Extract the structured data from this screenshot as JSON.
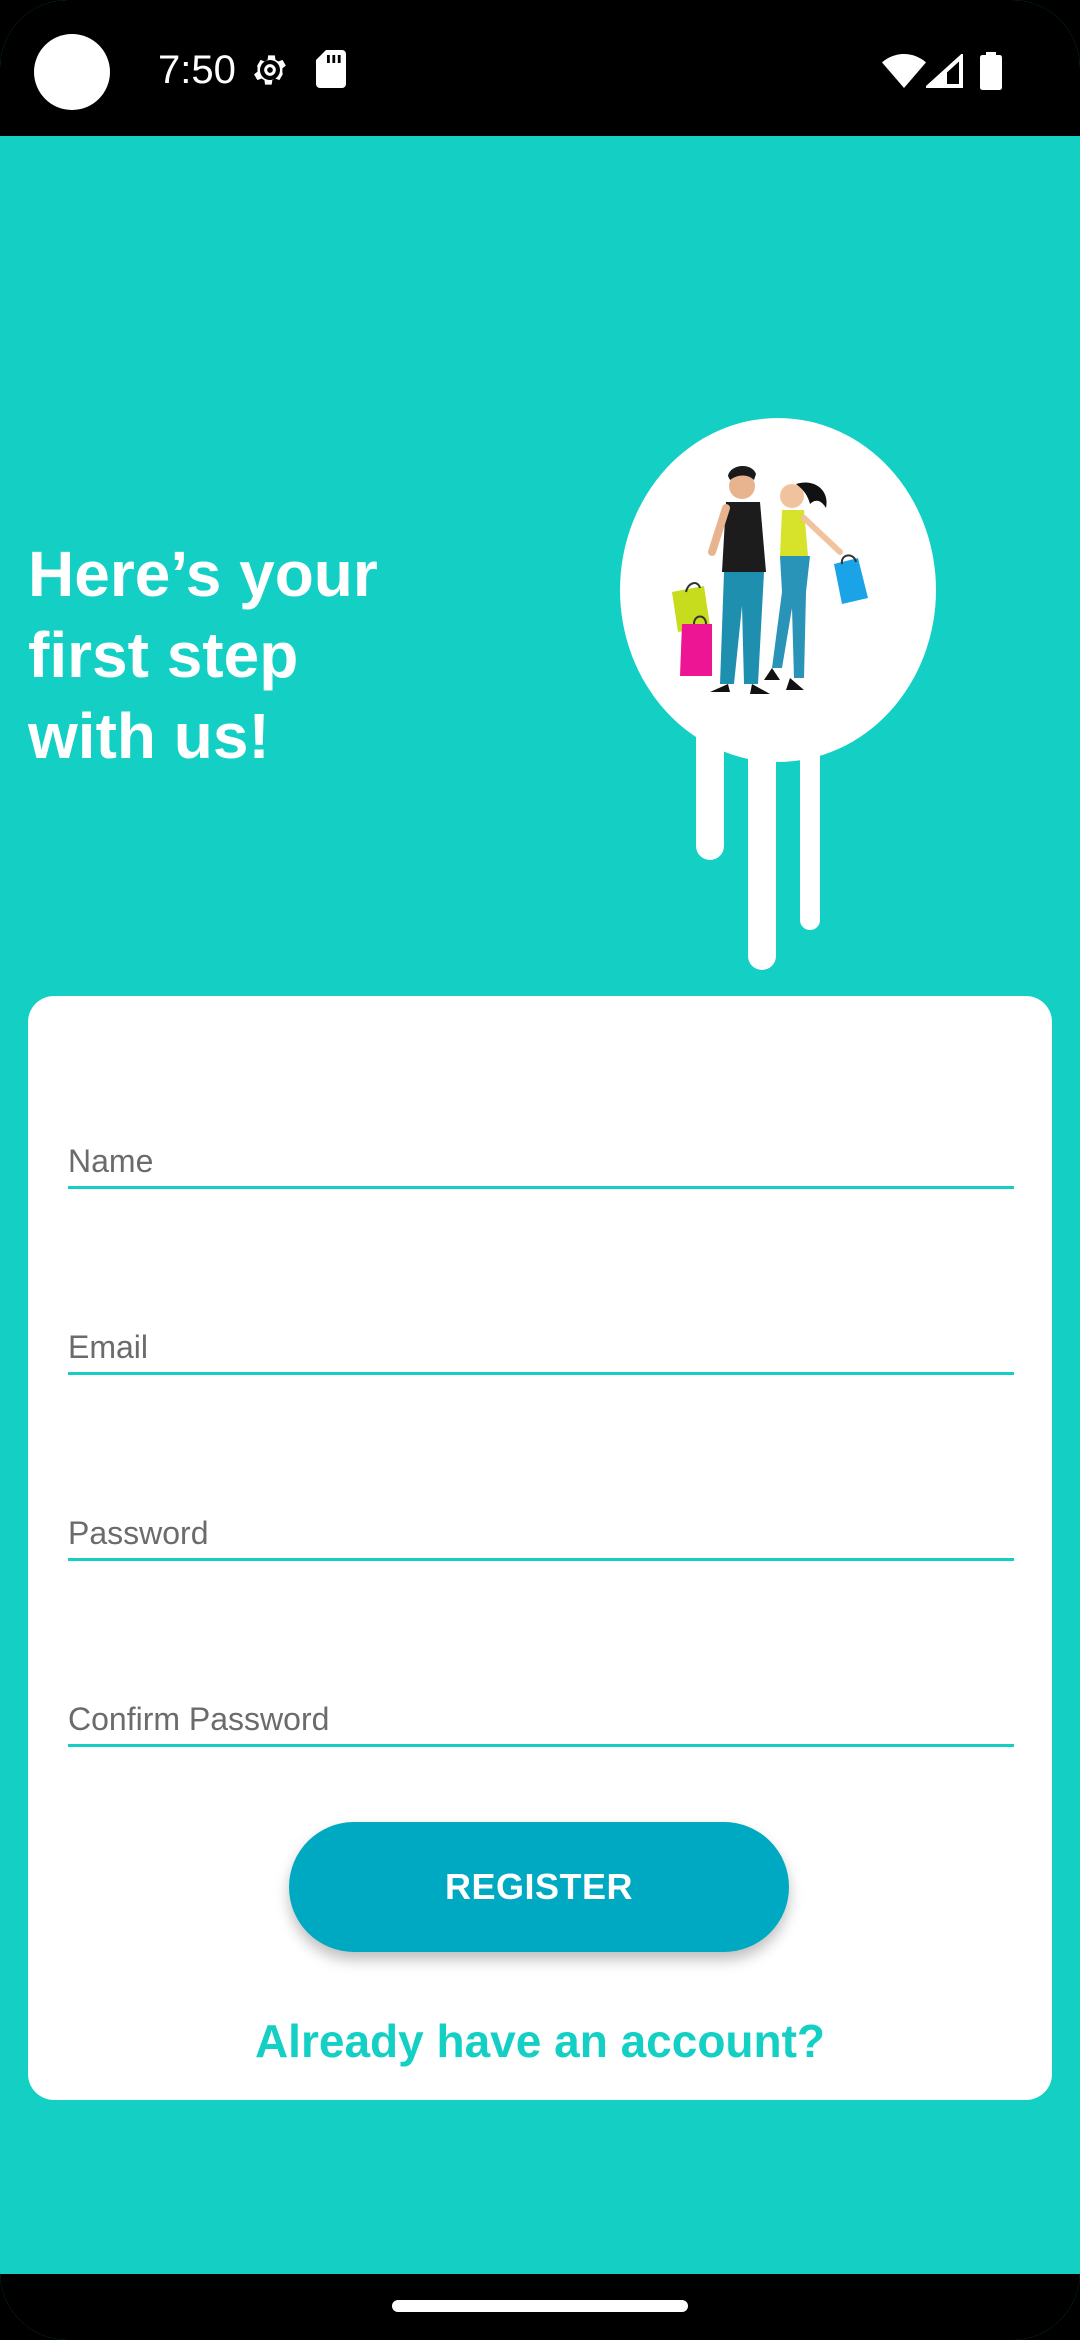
{
  "status_bar": {
    "time": "7:50",
    "icons": [
      "camera-cutout",
      "gear-icon",
      "sd-card-icon",
      "wifi-icon",
      "signal-icon",
      "battery-icon"
    ]
  },
  "header": {
    "headline": "Here’s your first step with us!"
  },
  "illustration": {
    "icon": "shopping-couple-illustration"
  },
  "form": {
    "name_placeholder": "Name",
    "email_placeholder": "Email",
    "password_placeholder": "Password",
    "confirm_password_placeholder": "Confirm Password",
    "register_label": "REGISTER",
    "login_link": "Already have an account?"
  },
  "colors": {
    "background": "#13CFC4",
    "button": "#00A9C2",
    "card": "#FFFFFF",
    "accent": "#13CFC4"
  }
}
